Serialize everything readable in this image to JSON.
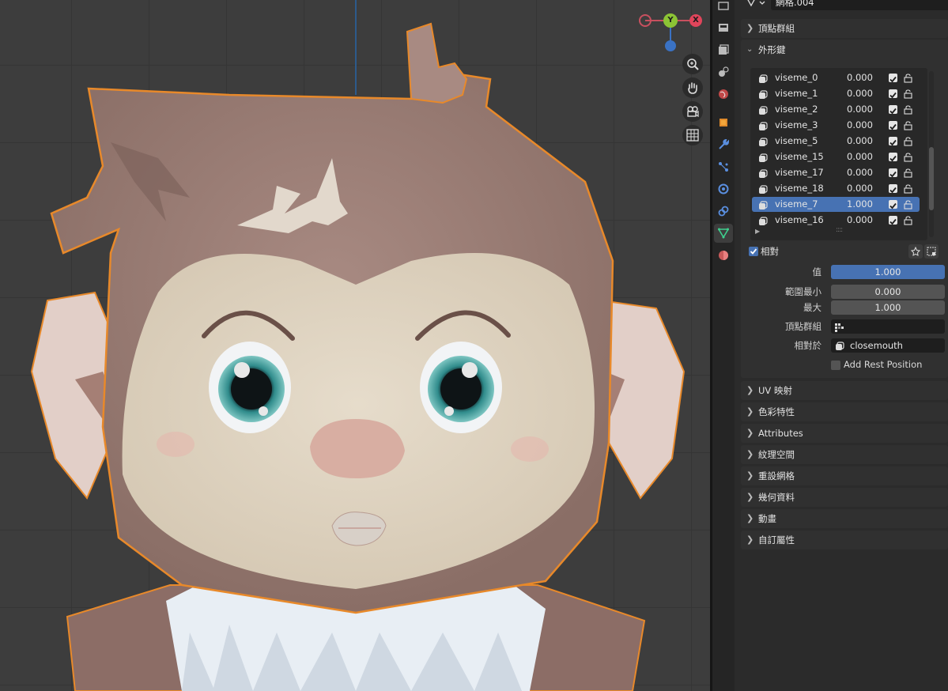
{
  "viewport": {
    "gizmo": {
      "y_label": "Y",
      "x_label": "X"
    },
    "nav_tools": [
      "zoom-icon",
      "hand-pan-icon",
      "camera-icon",
      "grid-icon"
    ]
  },
  "properties_tabs": [
    "render-icon",
    "output-icon",
    "view-layer-icon",
    "scene-icon",
    "world-icon",
    "object-icon",
    "modifier-icon",
    "particles-icon",
    "physics-icon",
    "constraints-icon",
    "data-icon",
    "material-icon"
  ],
  "properties": {
    "mesh_name": "網格.004",
    "panels_top": [
      {
        "label": "頂點群組",
        "expanded": false
      }
    ],
    "shape_keys": {
      "title": "外形鍵",
      "items": [
        {
          "name": "viseme_0",
          "value": "0.000",
          "selected": false
        },
        {
          "name": "viseme_1",
          "value": "0.000",
          "selected": false
        },
        {
          "name": "viseme_2",
          "value": "0.000",
          "selected": false
        },
        {
          "name": "viseme_3",
          "value": "0.000",
          "selected": false
        },
        {
          "name": "viseme_5",
          "value": "0.000",
          "selected": false
        },
        {
          "name": "viseme_15",
          "value": "0.000",
          "selected": false
        },
        {
          "name": "viseme_17",
          "value": "0.000",
          "selected": false
        },
        {
          "name": "viseme_18",
          "value": "0.000",
          "selected": false
        },
        {
          "name": "viseme_7",
          "value": "1.000",
          "selected": true
        },
        {
          "name": "viseme_16",
          "value": "0.000",
          "selected": false
        }
      ],
      "relative_label": "相對",
      "value_label": "值",
      "value": "1.000",
      "range_min_label": "範圍最小",
      "range_min": "0.000",
      "max_label": "最大",
      "max": "1.000",
      "vertex_group_label": "頂點群組",
      "vertex_group_value": "",
      "relative_to_label": "相對於",
      "relative_to_value": "closemouth",
      "add_rest_position": "Add Rest Position"
    },
    "panels_bottom": [
      "UV 映射",
      "色彩特性",
      "Attributes",
      "紋理空間",
      "重設網格",
      "幾何資料",
      "動畫",
      "自訂屬性"
    ]
  }
}
